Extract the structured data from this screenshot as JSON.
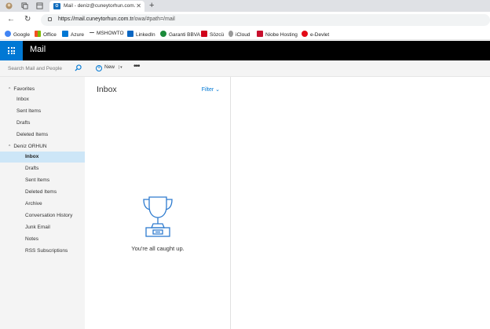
{
  "browser": {
    "tab_title": "Mail - deniz@cuneytorhun.com.tr",
    "tab_favicon_text": "O",
    "url_host": "https://mail.cuneytorhun.com.tr",
    "url_path": "/owa/#path=/mail"
  },
  "bookmarks": [
    {
      "label": "Google",
      "color": "#4285f4"
    },
    {
      "label": "Office",
      "color": "#eb3c00"
    },
    {
      "label": "Azure",
      "color": "#0078d4"
    },
    {
      "label": "MSHOWTO",
      "color": "#555555"
    },
    {
      "label": "LinkedIn",
      "color": "#0a66c2"
    },
    {
      "label": "Garanti BBVA",
      "color": "#1b8a3a"
    },
    {
      "label": "Sözcü",
      "color": "#d0021b"
    },
    {
      "label": "iCloud",
      "color": "#999999"
    },
    {
      "label": "Niobe Hosting",
      "color": "#c8102e"
    },
    {
      "label": "e-Devlet",
      "color": "#e30a17"
    }
  ],
  "app": {
    "title": "Mail",
    "accent": "#0078d4"
  },
  "search": {
    "placeholder": "Search Mail and People"
  },
  "command_bar": {
    "new_label": "New",
    "more_label": "•••"
  },
  "nav": {
    "favorites_label": "Favorites",
    "favorites": [
      "Inbox",
      "Sent Items",
      "Drafts",
      "Deleted Items"
    ],
    "account_label": "Deniz ORHUN",
    "folders": [
      "Inbox",
      "Drafts",
      "Sent Items",
      "Deleted Items",
      "Archive",
      "Conversation History",
      "Junk Email",
      "Notes",
      "RSS Subscriptions"
    ],
    "selected_folder": "Inbox"
  },
  "list": {
    "title": "Inbox",
    "filter_label": "Filter",
    "empty_message": "You're all caught up."
  }
}
